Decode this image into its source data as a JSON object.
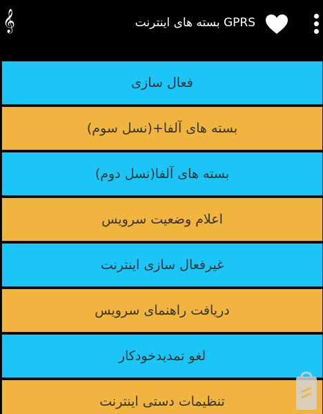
{
  "app_bar": {
    "title": "بسته های اینترنت GPRS",
    "overflow_icon": "overflow-menu-icon",
    "favorite_icon": "heart-icon",
    "left_icon": "music-note-icon"
  },
  "colors": {
    "blue_item": "#1bc5f7",
    "orange_item": "#f1b43f",
    "background": "#000000"
  },
  "menu": {
    "items": [
      {
        "label": "فعال سازی"
      },
      {
        "label": "بسته های آلفا+(نسل سوم)"
      },
      {
        "label": "بسته های آلفا(نسل دوم)"
      },
      {
        "label": "اعلام وضعیت سرویس"
      },
      {
        "label": "غیرفعال سازی اینترنت"
      },
      {
        "label": "دریافت راهنمای سرویس"
      },
      {
        "label": "لغو تمدیدخودکار"
      },
      {
        "label": "تنظیمات دستی اینترنت"
      }
    ]
  }
}
